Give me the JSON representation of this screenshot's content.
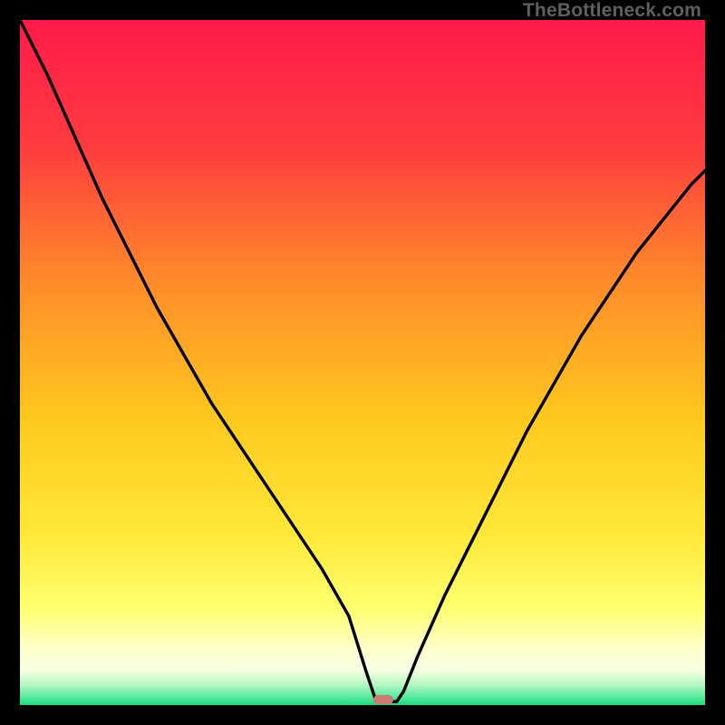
{
  "watermark": "TheBottleneck.com",
  "colors": {
    "top": "#ff1a4a",
    "mid1": "#ff6a2f",
    "mid2": "#ffd21a",
    "mid3": "#ffff66",
    "pale": "#ffffe0",
    "green": "#1fe07f",
    "frame": "#000000",
    "curve": "#000000",
    "marker": "#cf7a77"
  },
  "chart_data": {
    "type": "line",
    "title": "",
    "xlabel": "",
    "ylabel": "",
    "xlim": [
      0,
      100
    ],
    "ylim": [
      0,
      100
    ],
    "series": [
      {
        "name": "bottleneck-curve",
        "x": [
          0,
          4,
          8,
          12,
          16,
          20,
          24,
          28,
          32,
          36,
          40,
          44,
          48,
          50.5,
          52,
          54,
          55,
          56,
          58,
          62,
          66,
          70,
          74,
          78,
          82,
          86,
          90,
          94,
          98,
          100
        ],
        "values": [
          100,
          92,
          83,
          74,
          66,
          58,
          51,
          44,
          38,
          32,
          26,
          20,
          13,
          5,
          0.5,
          0.5,
          0.5,
          2,
          7,
          16,
          24,
          32,
          40,
          47,
          54,
          60,
          66,
          71,
          76,
          78
        ]
      }
    ],
    "optimum": {
      "x": 53,
      "y": 0.8
    }
  }
}
